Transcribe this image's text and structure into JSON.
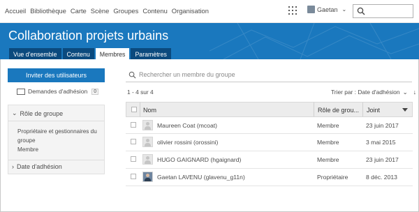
{
  "nav": {
    "links": [
      "Accueil",
      "Bibliothèque",
      "Carte",
      "Scène",
      "Groupes",
      "Contenu",
      "Organisation"
    ],
    "user_name": "Gaetan",
    "icons": {
      "apps": "apps-grid-icon",
      "search": "search-icon"
    }
  },
  "banner": {
    "title": "Collaboration projets urbains",
    "tabs": [
      "Vue d'ensemble",
      "Contenu",
      "Membres",
      "Paramètres"
    ],
    "active_tab": "Membres",
    "color": "#1a78be"
  },
  "sidebar": {
    "invite_label": "Inviter des utilisateurs",
    "requests_label": "Demandes d'adhésion",
    "requests_count": "0",
    "role_filter": {
      "title": "Rôle de groupe",
      "options": [
        "Propriétaire et gestionnaires du groupe",
        "Membre"
      ]
    },
    "date_filter": {
      "title": "Date d'adhésion"
    }
  },
  "main": {
    "search_placeholder": "Rechercher un membre du groupe",
    "result_count": "1 - 4 sur 4",
    "sort_label": "Trier par : Date d'adhésion",
    "columns": {
      "name": "Nom",
      "role": "Rôle de grou...",
      "joined": "Joint"
    },
    "rows": [
      {
        "name": "Maureen Coat (mcoat)",
        "role": "Membre",
        "joined": "23 juin 2017"
      },
      {
        "name": "olivier rossini (orossini)",
        "role": "Membre",
        "joined": "3 mai 2015"
      },
      {
        "name": "HUGO GAIGNARD (hgaignard)",
        "role": "Membre",
        "joined": "23 juin 2017"
      },
      {
        "name": "Gaetan LAVENU (glavenu_g11n)",
        "role": "Propriétaire",
        "joined": "8 déc. 2013"
      }
    ]
  }
}
